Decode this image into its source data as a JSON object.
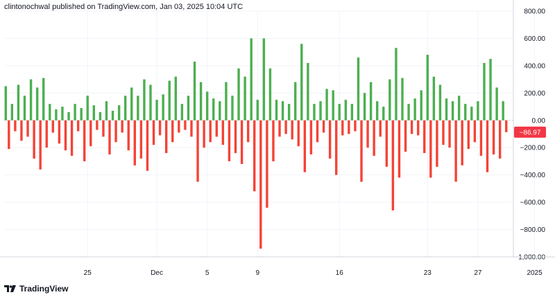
{
  "header": {
    "publish_note": "clintonochwal published on TradingView.com, Jan 03, 2025 10:04 UTC"
  },
  "footer": {
    "brand": "TradingView"
  },
  "colors": {
    "positive": "#4caf50",
    "negative": "#f44336",
    "last_value_bg": "#f23645",
    "grid": "#f0f3fa",
    "axis": "#d1d4dc"
  },
  "chart_data": {
    "type": "bar",
    "title": "",
    "xlabel": "",
    "ylabel": "",
    "ylim": [
      -1000,
      800
    ],
    "y_ticks": [
      "800.00",
      "600.00",
      "400.00",
      "200.00",
      "0.00",
      "−200.00",
      "−400.00",
      "−600.00",
      "−800.00",
      "−1,000.00"
    ],
    "x_ticks": [
      "25",
      "Dec",
      "5",
      "9",
      "16",
      "23",
      "27",
      "2025"
    ],
    "x_tick_index": [
      26,
      48,
      64,
      80,
      106,
      134,
      150,
      168
    ],
    "last_value_label": "−86.97",
    "last_value": -86.97,
    "grid": true,
    "series": [
      {
        "values": [
          250,
          -210,
          120,
          -80,
          260,
          -150,
          180,
          -120,
          300,
          -280,
          240,
          -360,
          310,
          -200,
          120,
          -90,
          80,
          -170,
          100,
          -220,
          60,
          -260,
          120,
          -80,
          90,
          -300,
          180,
          -190,
          110,
          -70,
          60,
          -120,
          140,
          -250,
          70,
          -160,
          110,
          -90,
          180,
          -220,
          240,
          -330,
          180,
          -280,
          300,
          -370,
          260,
          -180,
          150,
          -110,
          190,
          -240,
          290,
          -160,
          320,
          -90,
          120,
          -70,
          180,
          -120,
          430,
          -450,
          280,
          -200,
          210,
          -160,
          160,
          -120,
          140,
          -180,
          280,
          -300,
          180,
          -240,
          380,
          -320,
          320,
          -160,
          600,
          -520,
          150,
          -940,
          600,
          -640,
          380,
          -300,
          150,
          -120,
          140,
          -100,
          120,
          -140,
          280,
          -190,
          560,
          -380,
          420,
          -250,
          120,
          -160,
          140,
          -90,
          230,
          -280,
          220,
          -400,
          120,
          -110,
          150,
          -100,
          120,
          -80,
          460,
          -450,
          200,
          -200,
          280,
          -260,
          140,
          -120,
          100,
          -340,
          300,
          -660,
          530,
          -420,
          310,
          -230,
          120,
          -100,
          160,
          -110,
          220,
          -240,
          480,
          -420,
          320,
          -340,
          260,
          -180,
          160,
          -200,
          140,
          -450,
          180,
          -330,
          120,
          -210,
          100,
          -160,
          140,
          -260,
          420,
          -380,
          450,
          -250,
          240,
          -280,
          140,
          -87
        ]
      }
    ]
  }
}
